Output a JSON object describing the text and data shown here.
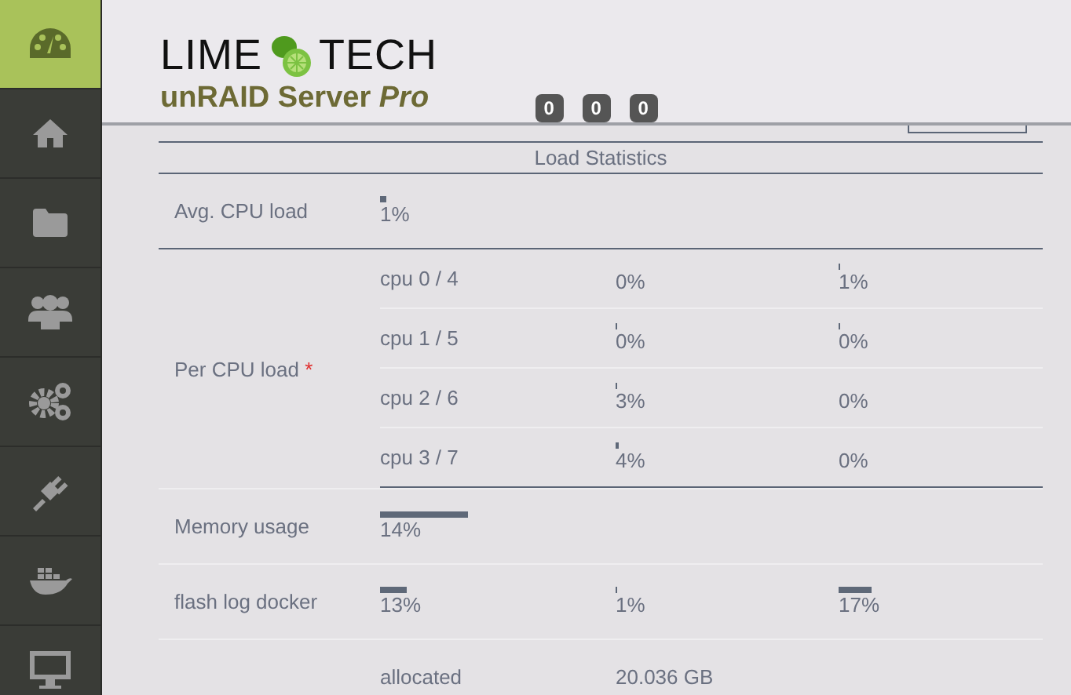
{
  "sidebar": {
    "items": [
      {
        "kind": "gauge",
        "selected": true
      },
      {
        "kind": "home",
        "selected": false
      },
      {
        "kind": "folder",
        "selected": false
      },
      {
        "kind": "users",
        "selected": false
      },
      {
        "kind": "gears",
        "selected": false
      },
      {
        "kind": "plug",
        "selected": false
      },
      {
        "kind": "whale",
        "selected": false
      },
      {
        "kind": "monitor",
        "selected": false
      }
    ]
  },
  "header": {
    "brand_left": "LIME",
    "brand_right": "TECH",
    "product": "unRAID Server *Pro*",
    "badges": [
      "0",
      "0",
      "0"
    ]
  },
  "table": {
    "title": "Load Statistics",
    "rows": [
      {
        "kind": "meters",
        "label": "Avg. CPU load",
        "meters": [
          {
            "reading": "1%"
          }
        ]
      },
      {
        "kind": "grid",
        "label": "Per CPU load",
        "marker": "*",
        "subrows": [
          {
            "label": "cpu 0 / 4",
            "meters": [
              {
                "reading": "0%"
              },
              {
                "reading": "1%"
              }
            ]
          },
          {
            "label": "cpu 1 / 5",
            "meters": [
              {
                "reading": "0%"
              },
              {
                "reading": "0%"
              }
            ]
          },
          {
            "label": "cpu 2 / 6",
            "meters": [
              {
                "reading": "3%"
              },
              {
                "reading": "0%"
              }
            ]
          },
          {
            "label": "cpu 3 / 7",
            "meters": [
              {
                "reading": "4%"
              },
              {
                "reading": "0%"
              }
            ]
          }
        ]
      },
      {
        "kind": "meters",
        "label": "Memory usage",
        "meters": [
          {
            "reading": "14%"
          }
        ]
      },
      {
        "kind": "meters",
        "label": "flash log docker",
        "meters": [
          {
            "reading": "13%"
          },
          {
            "reading": "1%"
          },
          {
            "reading": "17%"
          }
        ]
      },
      {
        "kind": "text",
        "cells": [
          "allocated",
          "20.036 GB"
        ]
      }
    ]
  }
}
